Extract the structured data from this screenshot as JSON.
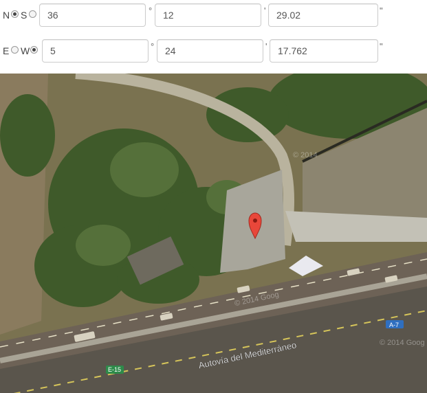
{
  "lat": {
    "dir_labels": [
      "N",
      "S"
    ],
    "selected": "N",
    "degrees": "36",
    "minutes": "12",
    "seconds": "29.02",
    "deg_symbol": "°",
    "min_symbol": "'",
    "sec_symbol": "\""
  },
  "lng": {
    "dir_labels": [
      "E",
      "W"
    ],
    "selected": "W",
    "degrees": "5",
    "minutes": "24",
    "seconds": "17.762",
    "deg_symbol": "°",
    "min_symbol": "'",
    "sec_symbol": "\""
  },
  "map": {
    "road_label": "Autovía del Mediterráneo",
    "shield_a7": "A-7",
    "shield_e15": "E-15",
    "copyright_1": "© 2014",
    "copyright_2": "© 2014 Goog",
    "copyright_3": "© 2014 Goog",
    "marker_icon": "map-pin-icon",
    "marker_color": "#e8473a"
  }
}
